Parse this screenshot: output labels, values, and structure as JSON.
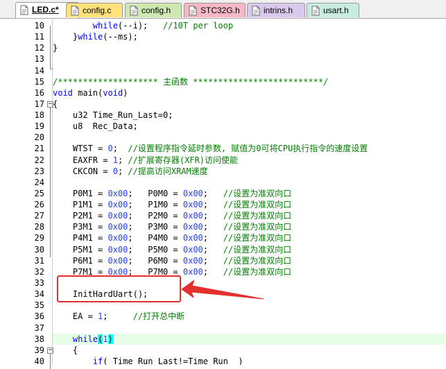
{
  "tabs": [
    {
      "label": "LED.c*",
      "color": "#ffffff",
      "icon": "c-file-icon",
      "active": true
    },
    {
      "label": "config.c",
      "color": "#ffe27a",
      "icon": "c-file-icon",
      "active": false
    },
    {
      "label": "config.h",
      "color": "#cde8b0",
      "icon": "h-file-icon",
      "active": false
    },
    {
      "label": "STC32G.h",
      "color": "#f6b8c4",
      "icon": "h-file-icon",
      "active": false
    },
    {
      "label": "intrins.h",
      "color": "#d8c8ee",
      "icon": "h-file-icon",
      "active": false
    },
    {
      "label": "usart.h",
      "color": "#c8ecdf",
      "icon": "h-file-icon",
      "active": false
    }
  ],
  "code_lines": [
    {
      "n": "10",
      "fold": "",
      "hl": false,
      "segs": [
        [
          "tx",
          "        "
        ],
        [
          "kw",
          "while"
        ],
        [
          "tx",
          "(--i);   "
        ],
        [
          "cm",
          "//10T per loop"
        ]
      ]
    },
    {
      "n": "11",
      "fold": "",
      "hl": false,
      "segs": [
        [
          "tx",
          "    }"
        ],
        [
          "kw",
          "while"
        ],
        [
          "tx",
          "(--ms);"
        ]
      ]
    },
    {
      "n": "12",
      "fold": "",
      "hl": false,
      "segs": [
        [
          "tx",
          "}"
        ]
      ]
    },
    {
      "n": "13",
      "fold": "",
      "hl": false,
      "segs": []
    },
    {
      "n": "14",
      "fold": "",
      "hl": false,
      "segs": []
    },
    {
      "n": "15",
      "fold": "",
      "hl": false,
      "segs": [
        [
          "cm",
          "/******************** 主函数 **************************/"
        ]
      ]
    },
    {
      "n": "16",
      "fold": "",
      "hl": false,
      "segs": [
        [
          "kw",
          "void"
        ],
        [
          "tx",
          " main("
        ],
        [
          "kw",
          "void"
        ],
        [
          "tx",
          ")"
        ]
      ]
    },
    {
      "n": "17",
      "fold": "-",
      "hl": false,
      "segs": [
        [
          "tx",
          "{"
        ]
      ]
    },
    {
      "n": "18",
      "fold": "",
      "hl": false,
      "segs": [
        [
          "tx",
          "    u32 Time_Run_Last=0;"
        ]
      ]
    },
    {
      "n": "19",
      "fold": "",
      "hl": false,
      "segs": [
        [
          "tx",
          "    u8  Rec_Data;"
        ]
      ]
    },
    {
      "n": "20",
      "fold": "",
      "hl": false,
      "segs": []
    },
    {
      "n": "21",
      "fold": "",
      "hl": false,
      "segs": [
        [
          "tx",
          "    WTST = "
        ],
        [
          "num",
          "0"
        ],
        [
          "tx",
          ";  "
        ],
        [
          "cm",
          "//设置程序指令延时参数, 赋值为0可将CPU执行指令的速度设置"
        ]
      ]
    },
    {
      "n": "22",
      "fold": "",
      "hl": false,
      "segs": [
        [
          "tx",
          "    EAXFR = "
        ],
        [
          "num",
          "1"
        ],
        [
          "tx",
          "; "
        ],
        [
          "cm",
          "//扩展寄存器(XFR)访问使能"
        ]
      ]
    },
    {
      "n": "23",
      "fold": "",
      "hl": false,
      "segs": [
        [
          "tx",
          "    CKCON = "
        ],
        [
          "num",
          "0"
        ],
        [
          "tx",
          "; "
        ],
        [
          "cm",
          "//提高访问XRAM速度"
        ]
      ]
    },
    {
      "n": "24",
      "fold": "",
      "hl": false,
      "segs": []
    },
    {
      "n": "25",
      "fold": "",
      "hl": false,
      "segs": [
        [
          "tx",
          "    P0M1 = "
        ],
        [
          "num",
          "0x00"
        ],
        [
          "tx",
          ";   P0M0 = "
        ],
        [
          "num",
          "0x00"
        ],
        [
          "tx",
          ";   "
        ],
        [
          "cm",
          "//设置为准双向口"
        ]
      ]
    },
    {
      "n": "26",
      "fold": "",
      "hl": false,
      "segs": [
        [
          "tx",
          "    P1M1 = "
        ],
        [
          "num",
          "0x00"
        ],
        [
          "tx",
          ";   P1M0 = "
        ],
        [
          "num",
          "0x00"
        ],
        [
          "tx",
          ";   "
        ],
        [
          "cm",
          "//设置为准双向口"
        ]
      ]
    },
    {
      "n": "27",
      "fold": "",
      "hl": false,
      "segs": [
        [
          "tx",
          "    P2M1 = "
        ],
        [
          "num",
          "0x00"
        ],
        [
          "tx",
          ";   P2M0 = "
        ],
        [
          "num",
          "0x00"
        ],
        [
          "tx",
          ";   "
        ],
        [
          "cm",
          "//设置为准双向口"
        ]
      ]
    },
    {
      "n": "28",
      "fold": "",
      "hl": false,
      "segs": [
        [
          "tx",
          "    P3M1 = "
        ],
        [
          "num",
          "0x00"
        ],
        [
          "tx",
          ";   P3M0 = "
        ],
        [
          "num",
          "0x00"
        ],
        [
          "tx",
          ";   "
        ],
        [
          "cm",
          "//设置为准双向口"
        ]
      ]
    },
    {
      "n": "29",
      "fold": "",
      "hl": false,
      "segs": [
        [
          "tx",
          "    P4M1 = "
        ],
        [
          "num",
          "0x00"
        ],
        [
          "tx",
          ";   P4M0 = "
        ],
        [
          "num",
          "0x00"
        ],
        [
          "tx",
          ";   "
        ],
        [
          "cm",
          "//设置为准双向口"
        ]
      ]
    },
    {
      "n": "30",
      "fold": "",
      "hl": false,
      "segs": [
        [
          "tx",
          "    P5M1 = "
        ],
        [
          "num",
          "0x00"
        ],
        [
          "tx",
          ";   P5M0 = "
        ],
        [
          "num",
          "0x00"
        ],
        [
          "tx",
          ";   "
        ],
        [
          "cm",
          "//设置为准双向口"
        ]
      ]
    },
    {
      "n": "31",
      "fold": "",
      "hl": false,
      "segs": [
        [
          "tx",
          "    P6M1 = "
        ],
        [
          "num",
          "0x00"
        ],
        [
          "tx",
          ";   P6M0 = "
        ],
        [
          "num",
          "0x00"
        ],
        [
          "tx",
          ";   "
        ],
        [
          "cm",
          "//设置为准双向口"
        ]
      ]
    },
    {
      "n": "32",
      "fold": "",
      "hl": false,
      "segs": [
        [
          "tx",
          "    P7M1 = "
        ],
        [
          "num",
          "0x00"
        ],
        [
          "tx",
          ";   P7M0 = "
        ],
        [
          "num",
          "0x00"
        ],
        [
          "tx",
          ";   "
        ],
        [
          "cm",
          "//设置为准双向口"
        ]
      ]
    },
    {
      "n": "33",
      "fold": "",
      "hl": false,
      "segs": []
    },
    {
      "n": "34",
      "fold": "",
      "hl": false,
      "segs": [
        [
          "tx",
          "    InitHardUart();"
        ]
      ]
    },
    {
      "n": "35",
      "fold": "",
      "hl": false,
      "segs": []
    },
    {
      "n": "36",
      "fold": "",
      "hl": false,
      "segs": [
        [
          "tx",
          "    EA = "
        ],
        [
          "num",
          "1"
        ],
        [
          "tx",
          ";     "
        ],
        [
          "cm",
          "//打开总中断"
        ]
      ]
    },
    {
      "n": "37",
      "fold": "",
      "hl": false,
      "segs": []
    },
    {
      "n": "38",
      "fold": "",
      "hl": true,
      "segs": [
        [
          "kw",
          "    while"
        ],
        [
          "brmatch",
          "("
        ],
        [
          "num",
          "1"
        ],
        [
          "brmatch",
          ")"
        ]
      ]
    },
    {
      "n": "39",
      "fold": "-",
      "hl": false,
      "segs": [
        [
          "tx",
          "    {"
        ]
      ]
    },
    {
      "n": "40",
      "fold": "",
      "hl": false,
      "segs": [
        [
          "tx",
          "        "
        ],
        [
          "kw",
          "if"
        ],
        [
          "tx",
          "( Time_Run_Last!=Time_Run  )"
        ]
      ]
    }
  ],
  "annotation": {
    "color": "#e3302d",
    "target": "InitHardUart();"
  }
}
